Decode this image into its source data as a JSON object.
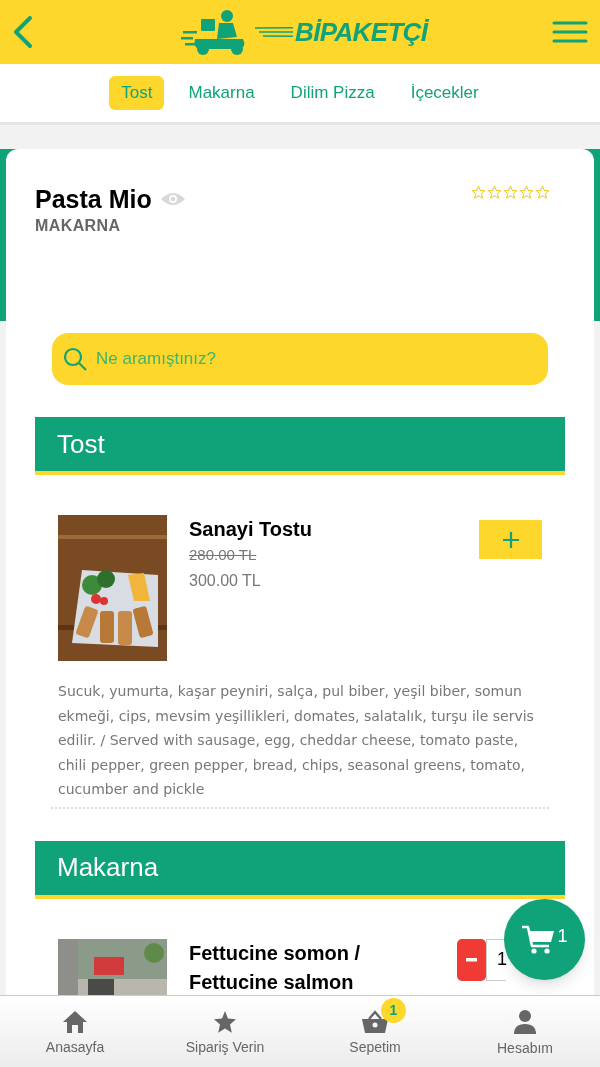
{
  "header": {
    "logo_text": "BİPAKETÇİ"
  },
  "category_tabs": [
    {
      "label": "Tost",
      "selected": true
    },
    {
      "label": "Makarna",
      "selected": false
    },
    {
      "label": "Dilim Pizza",
      "selected": false
    },
    {
      "label": "İçecekler",
      "selected": false
    }
  ],
  "restaurant": {
    "name": "Pasta Mio",
    "category": "MAKARNA",
    "stars": 0
  },
  "search": {
    "placeholder": "Ne aramıştınız?"
  },
  "sections": [
    {
      "title": "Tost",
      "items": [
        {
          "name": "Sanayi Tostu",
          "old_price": "280.00 TL",
          "price": "300.00 TL",
          "kind": "add",
          "description": "Sucuk, yumurta, kaşar peyniri, salça, pul biber, yeşil biber, somun ekmeği, cips, mevsim yeşillikleri, domates, salatalık, turşu ile servis edilir. / Served with sausage, egg, cheddar cheese, tomato paste, chili pepper, green pepper, bread, chips, seasonal greens, tomato, cucumber and pickle"
        }
      ]
    },
    {
      "title": "Makarna",
      "items": [
        {
          "name": "Fettucine somon / Fettucine salmon",
          "kind": "stepper",
          "quantity": "1"
        }
      ]
    }
  ],
  "cart_fab": {
    "count": "1"
  },
  "bottom_nav": [
    {
      "label": "Anasayfa"
    },
    {
      "label": "Sipariş Verin"
    },
    {
      "label": "Sepetim",
      "badge": "1"
    },
    {
      "label": "Hesabım"
    }
  ]
}
